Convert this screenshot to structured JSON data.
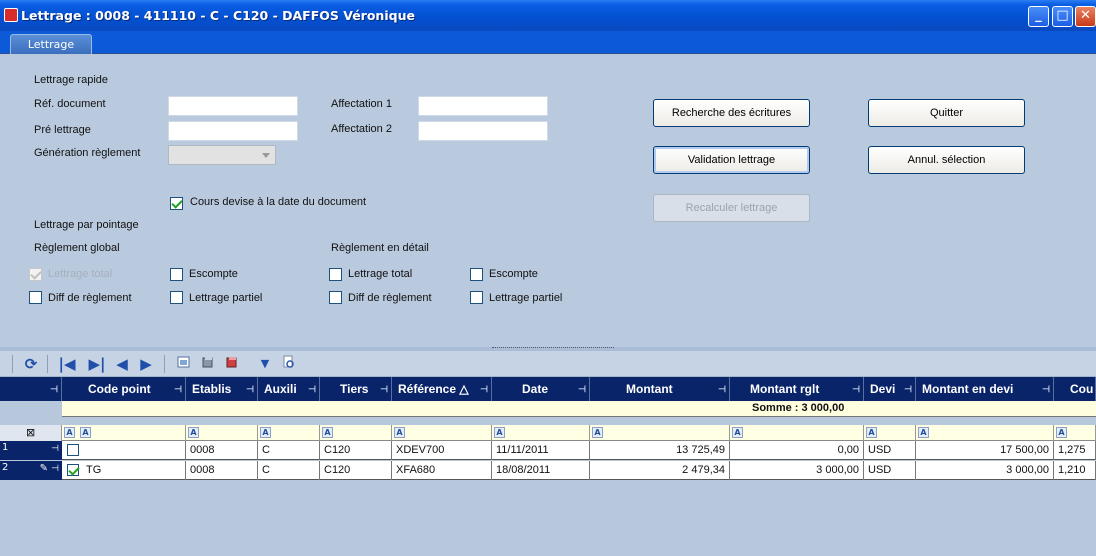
{
  "window": {
    "title": "Lettrage : 0008 - 411110 - C - C120 - DAFFOS Véronique",
    "minimize_glyph": "_",
    "maximize_glyph": "□",
    "close_glyph": "✕"
  },
  "tabs": [
    {
      "label": "Lettrage"
    }
  ],
  "form": {
    "section_quick": "Lettrage rapide",
    "ref_document_label": "Réf. document",
    "ref_document_value": "",
    "pre_lettrage_label": "Pré lettrage",
    "pre_lettrage_value": "",
    "generation_label": "Génération règlement",
    "generation_value": "",
    "affectation1_label": "Affectation 1",
    "affectation1_value": "",
    "affectation2_label": "Affectation 2",
    "affectation2_value": "",
    "cours_devise_label": "Cours devise à la date du document",
    "cours_devise_checked": true,
    "section_pointage": "Lettrage par pointage",
    "reglement_global": "Règlement global",
    "reglement_detail": "Règlement en détail",
    "global": {
      "lettrage_total": "Lettrage total",
      "escompte": "Escompte",
      "diff_reglement": "Diff de règlement",
      "lettrage_partiel": "Lettrage partiel"
    },
    "detail": {
      "lettrage_total": "Lettrage total",
      "escompte": "Escompte",
      "diff_reglement": "Diff de règlement",
      "lettrage_partiel": "Lettrage partiel"
    }
  },
  "buttons": {
    "recherche": "Recherche des écritures",
    "quitter": "Quitter",
    "validation": "Validation lettrage",
    "annul": "Annul. sélection",
    "recalculer": "Recalculer lettrage"
  },
  "toolbar": {
    "refresh": "⟳",
    "first": "|◀",
    "last": "▶|",
    "prev": "◀",
    "next": "▶",
    "dropdown": "▼"
  },
  "grid": {
    "columns": [
      {
        "label": ""
      },
      {
        "label": "Code point"
      },
      {
        "label": "Etablis"
      },
      {
        "label": "Auxili"
      },
      {
        "label": "Tiers"
      },
      {
        "label": "Référence △"
      },
      {
        "label": "Date"
      },
      {
        "label": "Montant"
      },
      {
        "label": "Montant rglt"
      },
      {
        "label": "Devi"
      },
      {
        "label": "Montant en devi"
      },
      {
        "label": "Cou"
      }
    ],
    "sum_label": "Somme : 3 000,00",
    "rows": [
      {
        "num": "1",
        "checked": false,
        "code_point": "",
        "etablis": "0008",
        "auxili": "C",
        "tiers": "C120",
        "reference": "XDEV700",
        "date": "11/11/2011",
        "montant": "13 725,49",
        "montant_rglt": "0,00",
        "devise": "USD",
        "montant_devise": "17 500,00",
        "cours": "1,275"
      },
      {
        "num": "2",
        "checked": true,
        "code_point": "TG",
        "etablis": "0008",
        "auxili": "C",
        "tiers": "C120",
        "reference": "XFA680",
        "date": "18/08/2011",
        "montant": "2 479,34",
        "montant_rglt": "3 000,00",
        "devise": "USD",
        "montant_devise": "3 000,00",
        "cours": "1,210"
      }
    ]
  },
  "colors": {
    "titlebar": "#0350d0",
    "grid_header": "#0a246a",
    "panel": "#b9c9de"
  }
}
